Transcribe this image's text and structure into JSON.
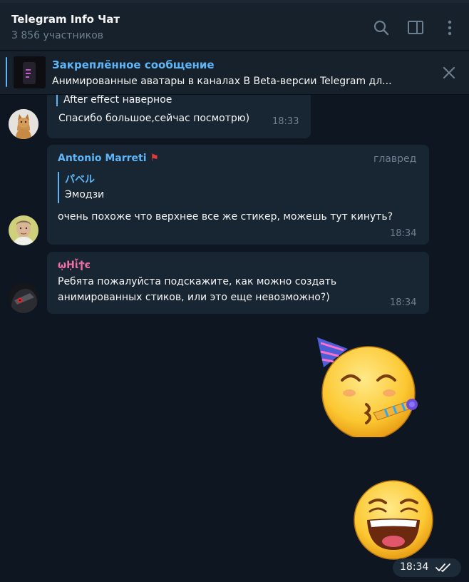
{
  "header": {
    "title": "Telegram Info Чат",
    "subtitle": "3 856 участников",
    "icons": [
      "search-icon",
      "sidebar-toggle-icon",
      "more-vertical-icon"
    ]
  },
  "pinned": {
    "title": "Закреплённое сообщение",
    "text": "Анимированные аватары в каналах  В Beta-версии Telegram дл...",
    "close_icon": "close-icon"
  },
  "messages": [
    {
      "reply_text": "After effect наверное",
      "text": "Спасибо большое,сейчас посмотрю)",
      "time": "18:33"
    },
    {
      "author": "Antonio Marreti",
      "author_flag": "🚩",
      "author_color": "#5eb5f7",
      "admin_tag": "главред",
      "reply_author": "パベル",
      "reply_text": "Эмодзи",
      "text": "очень похоже что верхнее все же стикер, можешь тут кинуть?",
      "time": "18:34"
    },
    {
      "author": "ῳῌἷϯє",
      "author_color": "#ee6fa3",
      "text_line1": "Ребята пожалуйста подскажите, как можно создать",
      "text_line2": "анимированных стиков, или это еще невозможно?)",
      "time": "18:34"
    }
  ],
  "stickers": [
    "party-face-sticker",
    "laughing-face-sticker"
  ],
  "outgoing": {
    "time": "18:34",
    "status_icon": "double-check-icon"
  }
}
